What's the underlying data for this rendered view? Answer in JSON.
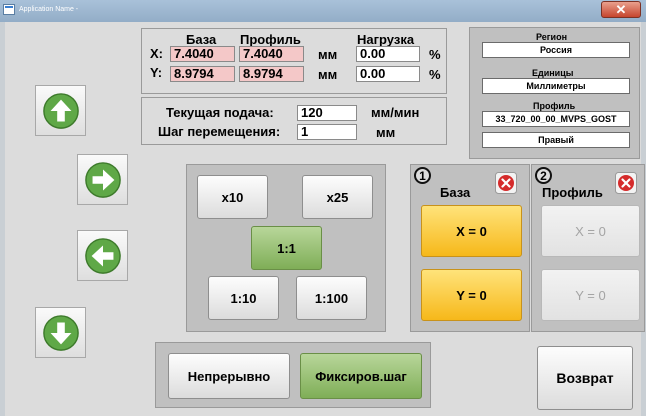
{
  "window": {
    "title": "Application Name -",
    "close_label": "✕"
  },
  "coords": {
    "header_base": "База",
    "header_profile": "Профиль",
    "header_load": "Нагрузка",
    "x_label": "X:",
    "y_label": "Y:",
    "x_base": "7.4040",
    "x_profile": "7.4040",
    "y_base": "8.9794",
    "y_profile": "8.9794",
    "unit_x": "мм",
    "unit_y": "мм",
    "x_load": "0.00",
    "y_load": "0.00",
    "pct_x": "%",
    "pct_y": "%"
  },
  "feed": {
    "current_label": "Текущая подача:",
    "current_value": "120",
    "current_unit": "мм/мин",
    "step_label": "Шаг перемещения:",
    "step_value": "1",
    "step_unit": "мм"
  },
  "settings": {
    "region_label": "Регион",
    "region_value": "Россия",
    "units_label": "Единицы",
    "units_value": "Миллиметры",
    "profile_label": "Профиль",
    "profile_value": "33_720_00_00_MVPS_GOST",
    "side_value": "Правый"
  },
  "scale": {
    "x10": "x10",
    "x25": "x25",
    "x1": "1:1",
    "x1_10": "1:10",
    "x1_100": "1:100"
  },
  "base_panel": {
    "number": "1",
    "title": "База",
    "x_zero": "X = 0",
    "y_zero": "Y = 0"
  },
  "profile_panel": {
    "number": "2",
    "title": "Профиль",
    "x_zero": "X = 0",
    "y_zero": "Y = 0"
  },
  "mode": {
    "continuous": "Непрерывно",
    "fixed_step": "Фиксиров.шаг"
  },
  "return_label": "Возврат",
  "colors": {
    "active_green": "#8cbc63",
    "orange": "#f8c232",
    "pink_field": "#f4c8c8",
    "red_close": "#d52b2b"
  },
  "icons": [
    "arrow-up-icon",
    "arrow-right-icon",
    "arrow-left-icon",
    "arrow-down-icon",
    "close-icon"
  ]
}
